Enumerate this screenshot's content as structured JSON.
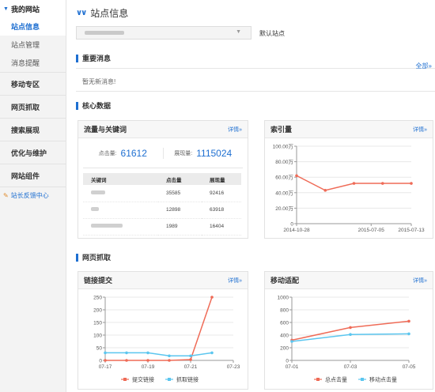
{
  "sidebar": {
    "head": "我的网站",
    "subs": [
      "站点信息",
      "站点管理",
      "消息提醒"
    ],
    "items": [
      "移动专区",
      "网页抓取",
      "搜索展现",
      "优化与维护",
      "网站组件"
    ],
    "feedback": "站长反馈中心"
  },
  "main": {
    "title": "站点信息",
    "default_site": "默认站点"
  },
  "messages": {
    "title": "重要消息",
    "more": "全部»",
    "empty": "暂无新消息!"
  },
  "core": {
    "title": "核心数据",
    "traffic": {
      "title": "流量与关键词",
      "detail": "详情»",
      "clicks_label": "点击量:",
      "clicks": "61612",
      "impressions_label": "展现量:",
      "impressions": "1115024",
      "headers": [
        "关键词",
        "点击量",
        "展现量"
      ],
      "rows": [
        {
          "clicks": "35585",
          "impressions": "92416"
        },
        {
          "clicks": "12898",
          "impressions": "63918"
        },
        {
          "clicks": "1989",
          "impressions": "16404"
        }
      ]
    },
    "index": {
      "title": "索引量",
      "detail": "详情»"
    }
  },
  "crawl": {
    "title": "网页抓取",
    "links": {
      "title": "链接提交",
      "detail": "详情»"
    },
    "mobile": {
      "title": "移动适配",
      "detail": "详情»"
    }
  },
  "chart_data": [
    {
      "type": "line",
      "title": "索引量",
      "y_ticks": [
        "0",
        "20.00万",
        "40.00万",
        "60.00万",
        "80.00万",
        "100.00万"
      ],
      "x_ticks": [
        "2014-10-28",
        "2015-07-05",
        "2015-07-13"
      ],
      "ylim": [
        0,
        100
      ],
      "series": [
        {
          "color": "#ef6b57",
          "x": [
            0,
            1,
            2,
            3,
            4
          ],
          "values": [
            62,
            43,
            52,
            52,
            52
          ]
        }
      ]
    },
    {
      "type": "line",
      "title": "链接提交",
      "y_ticks": [
        "0",
        "50",
        "100",
        "150",
        "200",
        "250"
      ],
      "x_ticks": [
        "07-17",
        "07-19",
        "07-21",
        "07-23"
      ],
      "ylim": [
        0,
        250
      ],
      "x_range": [
        17,
        23
      ],
      "legend": [
        "提交链接",
        "抓取链接"
      ],
      "series": [
        {
          "name": "提交链接",
          "color": "#ef6b57",
          "x": [
            17,
            18,
            19,
            20,
            21,
            22
          ],
          "values": [
            0,
            0,
            0,
            0,
            3,
            250
          ]
        },
        {
          "name": "抓取链接",
          "color": "#5bc6ef",
          "x": [
            17,
            18,
            19,
            20,
            21,
            22
          ],
          "values": [
            30,
            30,
            30,
            18,
            18,
            30
          ]
        }
      ]
    },
    {
      "type": "line",
      "title": "移动适配",
      "y_ticks": [
        "0",
        "200",
        "400",
        "600",
        "800",
        "1000"
      ],
      "x_ticks": [
        "07-01",
        "07-03",
        "07-05"
      ],
      "ylim": [
        0,
        1000
      ],
      "x_range": [
        1,
        5
      ],
      "legend": [
        "总点击量",
        "移动点击量"
      ],
      "series": [
        {
          "name": "总点击量",
          "color": "#ef6b57",
          "x": [
            1,
            3,
            5
          ],
          "values": [
            320,
            520,
            620
          ]
        },
        {
          "name": "移动点击量",
          "color": "#5bc6ef",
          "x": [
            1,
            3,
            5
          ],
          "values": [
            300,
            410,
            420
          ]
        }
      ]
    }
  ]
}
